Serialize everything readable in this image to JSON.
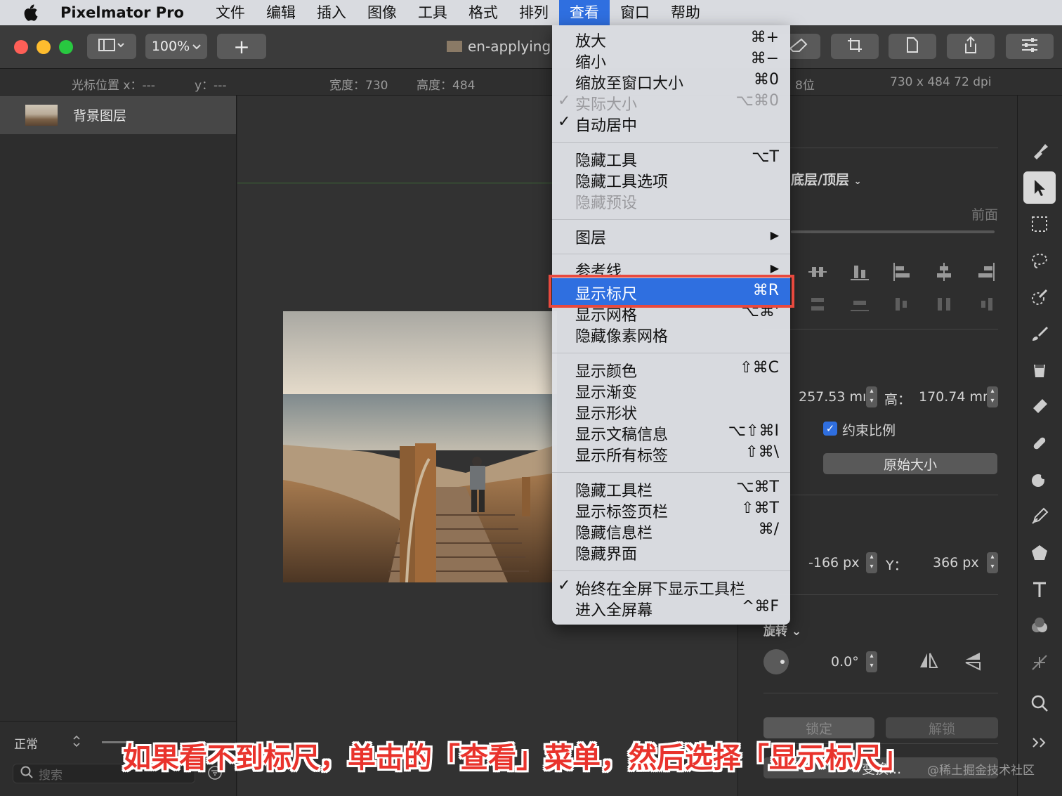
{
  "menubar": {
    "app": "Pixelmator Pro",
    "items": [
      "文件",
      "编辑",
      "插入",
      "图像",
      "工具",
      "格式",
      "排列",
      "查看",
      "窗口",
      "帮助"
    ],
    "active": "查看"
  },
  "toolbar": {
    "zoom": "100%",
    "add": "+",
    "doc_title": "en-applying"
  },
  "infobar": {
    "cursor_x": "光标位置 x：---",
    "cursor_y": "y：---",
    "width": "宽度：730",
    "height": "高度：484",
    "depth": "8位",
    "size": "730 x 484 72 dpi"
  },
  "layers": {
    "layer_name": "背景图层",
    "blend_mode": "正常",
    "search_placeholder": "搜索"
  },
  "view_menu": {
    "items": [
      {
        "label": "放大",
        "shortcut": "⌘+"
      },
      {
        "label": "缩小",
        "shortcut": "⌘−"
      },
      {
        "label": "缩放至窗口大小",
        "shortcut": "⌘0"
      },
      {
        "label": "实际大小",
        "shortcut": "⌥⌘0",
        "checked": "✓",
        "disabled": true
      },
      {
        "label": "自动居中",
        "shortcut": "",
        "checked": "✓"
      },
      {
        "label": "隐藏工具",
        "shortcut": "⌥T"
      },
      {
        "label": "隐藏工具选项",
        "shortcut": ""
      },
      {
        "label": "隐藏预设",
        "shortcut": "",
        "disabled": true
      },
      {
        "label": "图层",
        "shortcut": "▶"
      },
      {
        "label": "参考线",
        "shortcut": "▶"
      },
      {
        "label": "显示标尺",
        "shortcut": "⌘R"
      },
      {
        "label": "显示网格",
        "shortcut": "⌥⌘'"
      },
      {
        "label": "隐藏像素网格",
        "shortcut": ""
      },
      {
        "label": "显示颜色",
        "shortcut": "⇧⌘C"
      },
      {
        "label": "显示渐变",
        "shortcut": ""
      },
      {
        "label": "显示形状",
        "shortcut": ""
      },
      {
        "label": "显示文稿信息",
        "shortcut": "⌥⇧⌘I"
      },
      {
        "label": "显示所有标签",
        "shortcut": "⇧⌘\\"
      },
      {
        "label": "隐藏工具栏",
        "shortcut": "⌥⌘T"
      },
      {
        "label": "显示标签页栏",
        "shortcut": "⇧⌘T"
      },
      {
        "label": "隐藏信息栏",
        "shortcut": "⌘/"
      },
      {
        "label": "隐藏界面",
        "shortcut": ""
      },
      {
        "label": "始终在全屏下显示工具栏",
        "shortcut": "",
        "checked": "✓"
      },
      {
        "label": "进入全屏幕",
        "shortcut": "^⌘F"
      }
    ]
  },
  "inspector": {
    "arrange_label": "底层/顶层",
    "front_label": "前面",
    "width_value": "257.53 mı",
    "height_label": "高：",
    "height_value": "170.74 mr",
    "constrain_label": "约束比例",
    "original_size": "原始大小",
    "x_value": "-166 px",
    "y_label": "Y：",
    "y_value": "366 px",
    "rotate_label": "旋转",
    "rotate_value": "0.0°",
    "lock": "锁定",
    "unlock": "解锁",
    "transform": "变换..."
  },
  "caption": "如果看不到标尺，单击的「查看」菜单，然后选择「显示标尺」",
  "watermark": "@稀土掘金技术社区",
  "colors": {
    "highlight": "#2f6fe0",
    "callout": "#e8493e",
    "caption": "#e9332c"
  }
}
